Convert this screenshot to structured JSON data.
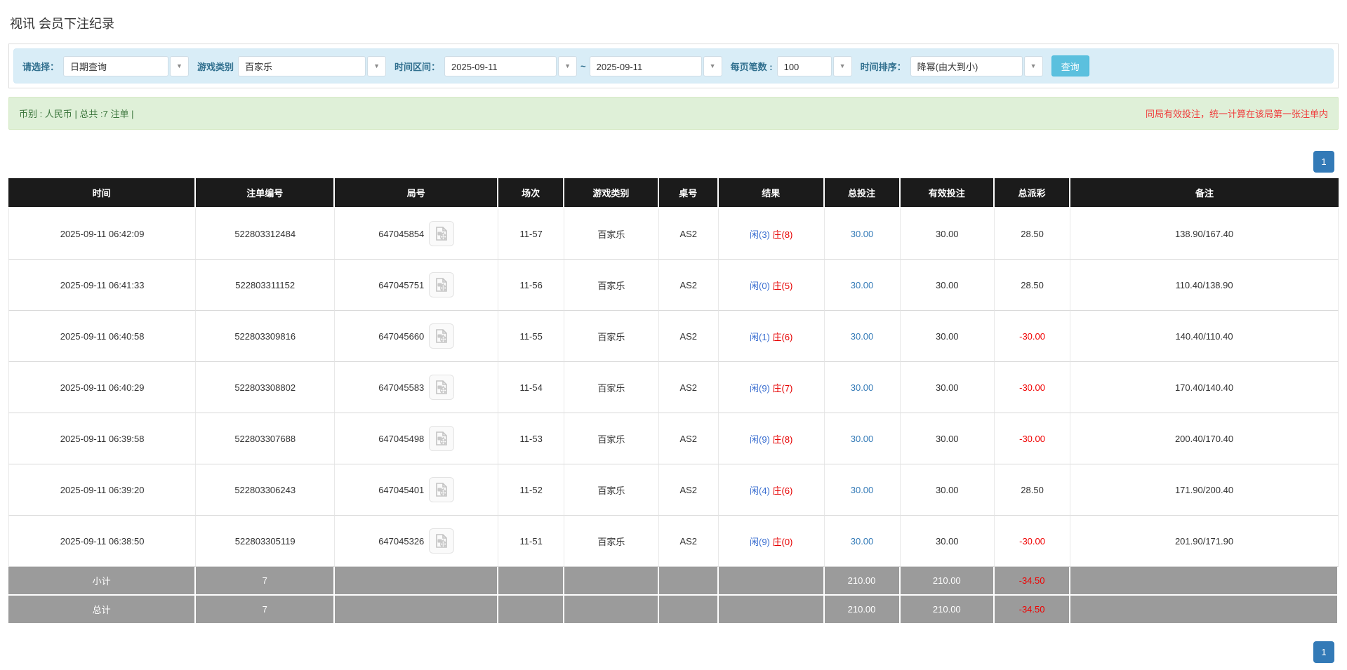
{
  "page": {
    "title": "视讯 会员下注纪录"
  },
  "filters": {
    "select_label": "请选择：",
    "select_value": "日期查询",
    "game_type_label": "游戏类别",
    "game_type_value": "百家乐",
    "time_range_label": "时间区间：",
    "date_from": "2025-09-11",
    "tilde": "~",
    "date_to": "2025-09-11",
    "page_size_label": "每页笔数 :",
    "page_size_value": "100",
    "sort_label": "时间排序：",
    "sort_value": "降幂(由大到小)",
    "search_button": "查询",
    "dropdown_arrow": "▼"
  },
  "summary": {
    "left_text": "币别 : 人民币 | 总共 :7 注单 |",
    "right_text": "同局有效投注，统一计算在该局第一张注单内"
  },
  "pagination": {
    "page": "1"
  },
  "table": {
    "headers": [
      "时间",
      "注单编号",
      "局号",
      "场次",
      "游戏类别",
      "桌号",
      "结果",
      "总投注",
      "有效投注",
      "总派彩",
      "备注"
    ],
    "rows": [
      {
        "time": "2025-09-11 06:42:09",
        "bet_id": "522803312484",
        "round_id": "647045854",
        "session": "11-57",
        "game": "百家乐",
        "table_no": "AS2",
        "player": "闲(3)",
        "banker": "庄(8)",
        "total_bet": "30.00",
        "valid_bet": "30.00",
        "payout": "28.50",
        "remark": "138.90/167.40"
      },
      {
        "time": "2025-09-11 06:41:33",
        "bet_id": "522803311152",
        "round_id": "647045751",
        "session": "11-56",
        "game": "百家乐",
        "table_no": "AS2",
        "player": "闲(0)",
        "banker": "庄(5)",
        "total_bet": "30.00",
        "valid_bet": "30.00",
        "payout": "28.50",
        "remark": "110.40/138.90"
      },
      {
        "time": "2025-09-11 06:40:58",
        "bet_id": "522803309816",
        "round_id": "647045660",
        "session": "11-55",
        "game": "百家乐",
        "table_no": "AS2",
        "player": "闲(1)",
        "banker": "庄(6)",
        "total_bet": "30.00",
        "valid_bet": "30.00",
        "payout": "-30.00",
        "remark": "140.40/110.40"
      },
      {
        "time": "2025-09-11 06:40:29",
        "bet_id": "522803308802",
        "round_id": "647045583",
        "session": "11-54",
        "game": "百家乐",
        "table_no": "AS2",
        "player": "闲(9)",
        "banker": "庄(7)",
        "total_bet": "30.00",
        "valid_bet": "30.00",
        "payout": "-30.00",
        "remark": "170.40/140.40"
      },
      {
        "time": "2025-09-11 06:39:58",
        "bet_id": "522803307688",
        "round_id": "647045498",
        "session": "11-53",
        "game": "百家乐",
        "table_no": "AS2",
        "player": "闲(9)",
        "banker": "庄(8)",
        "total_bet": "30.00",
        "valid_bet": "30.00",
        "payout": "-30.00",
        "remark": "200.40/170.40"
      },
      {
        "time": "2025-09-11 06:39:20",
        "bet_id": "522803306243",
        "round_id": "647045401",
        "session": "11-52",
        "game": "百家乐",
        "table_no": "AS2",
        "player": "闲(4)",
        "banker": "庄(6)",
        "total_bet": "30.00",
        "valid_bet": "30.00",
        "payout": "28.50",
        "remark": "171.90/200.40"
      },
      {
        "time": "2025-09-11 06:38:50",
        "bet_id": "522803305119",
        "round_id": "647045326",
        "session": "11-51",
        "game": "百家乐",
        "table_no": "AS2",
        "player": "闲(9)",
        "banker": "庄(0)",
        "total_bet": "30.00",
        "valid_bet": "30.00",
        "payout": "-30.00",
        "remark": "201.90/171.90"
      }
    ],
    "subtotal": {
      "label": "小计",
      "count": "7",
      "total_bet": "210.00",
      "valid_bet": "210.00",
      "payout": "-34.50"
    },
    "total": {
      "label": "总计",
      "count": "7",
      "total_bet": "210.00",
      "valid_bet": "210.00",
      "payout": "-34.50"
    }
  },
  "icons": {
    "video_replay": "video-file-icon"
  },
  "colors": {
    "toolbar_bg": "#d9edf7",
    "toolbar_label": "#31708f",
    "search_button_bg": "#5bc0de",
    "alert_bg": "#dff0d8",
    "alert_text": "#3c763d",
    "alert_warning_text": "#f03b3b",
    "header_bg": "#1b1b1b",
    "sum_row_bg": "#9b9b9b",
    "link_blue": "#337ab7",
    "player_blue": "#3a6ed0",
    "banker_red": "#e60000",
    "negative_red": "#f00000"
  }
}
